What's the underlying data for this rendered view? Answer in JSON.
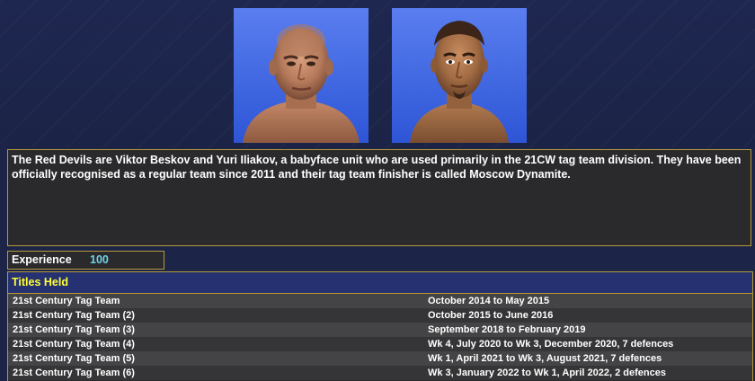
{
  "portraits": [
    {
      "name": "viktor-beskov-portrait"
    },
    {
      "name": "yuri-iliakov-portrait"
    }
  ],
  "bio": "The Red Devils are Viktor Beskov and Yuri Iliakov, a babyface unit who are used primarily in the 21CW tag team division. They have been officially recognised as a regular team since 2011 and their tag team finisher is called Moscow Dynamite.",
  "experience": {
    "label": "Experience",
    "value": "100"
  },
  "titles": {
    "header": "Titles Held",
    "rows": [
      {
        "name": "21st Century Tag Team",
        "dates": "October 2014 to May 2015"
      },
      {
        "name": "21st Century Tag Team (2)",
        "dates": "October 2015 to June 2016"
      },
      {
        "name": "21st Century Tag Team (3)",
        "dates": "September 2018 to February 2019"
      },
      {
        "name": "21st Century Tag Team (4)",
        "dates": "Wk 4, July 2020 to Wk 3, December 2020, 7 defences"
      },
      {
        "name": "21st Century Tag Team (5)",
        "dates": "Wk 1, April 2021 to Wk 3, August 2021, 7 defences"
      },
      {
        "name": "21st Century Tag Team (6)",
        "dates": "Wk 3, January 2022 to Wk 1, April 2022, 2 defences"
      }
    ]
  },
  "colors": {
    "background": "#1c2447",
    "panel": "#2a2a2c",
    "border": "#b89a3a",
    "header_bg": "#253170",
    "header_text": "#ffff33",
    "experience_value": "#6fd3e8"
  }
}
